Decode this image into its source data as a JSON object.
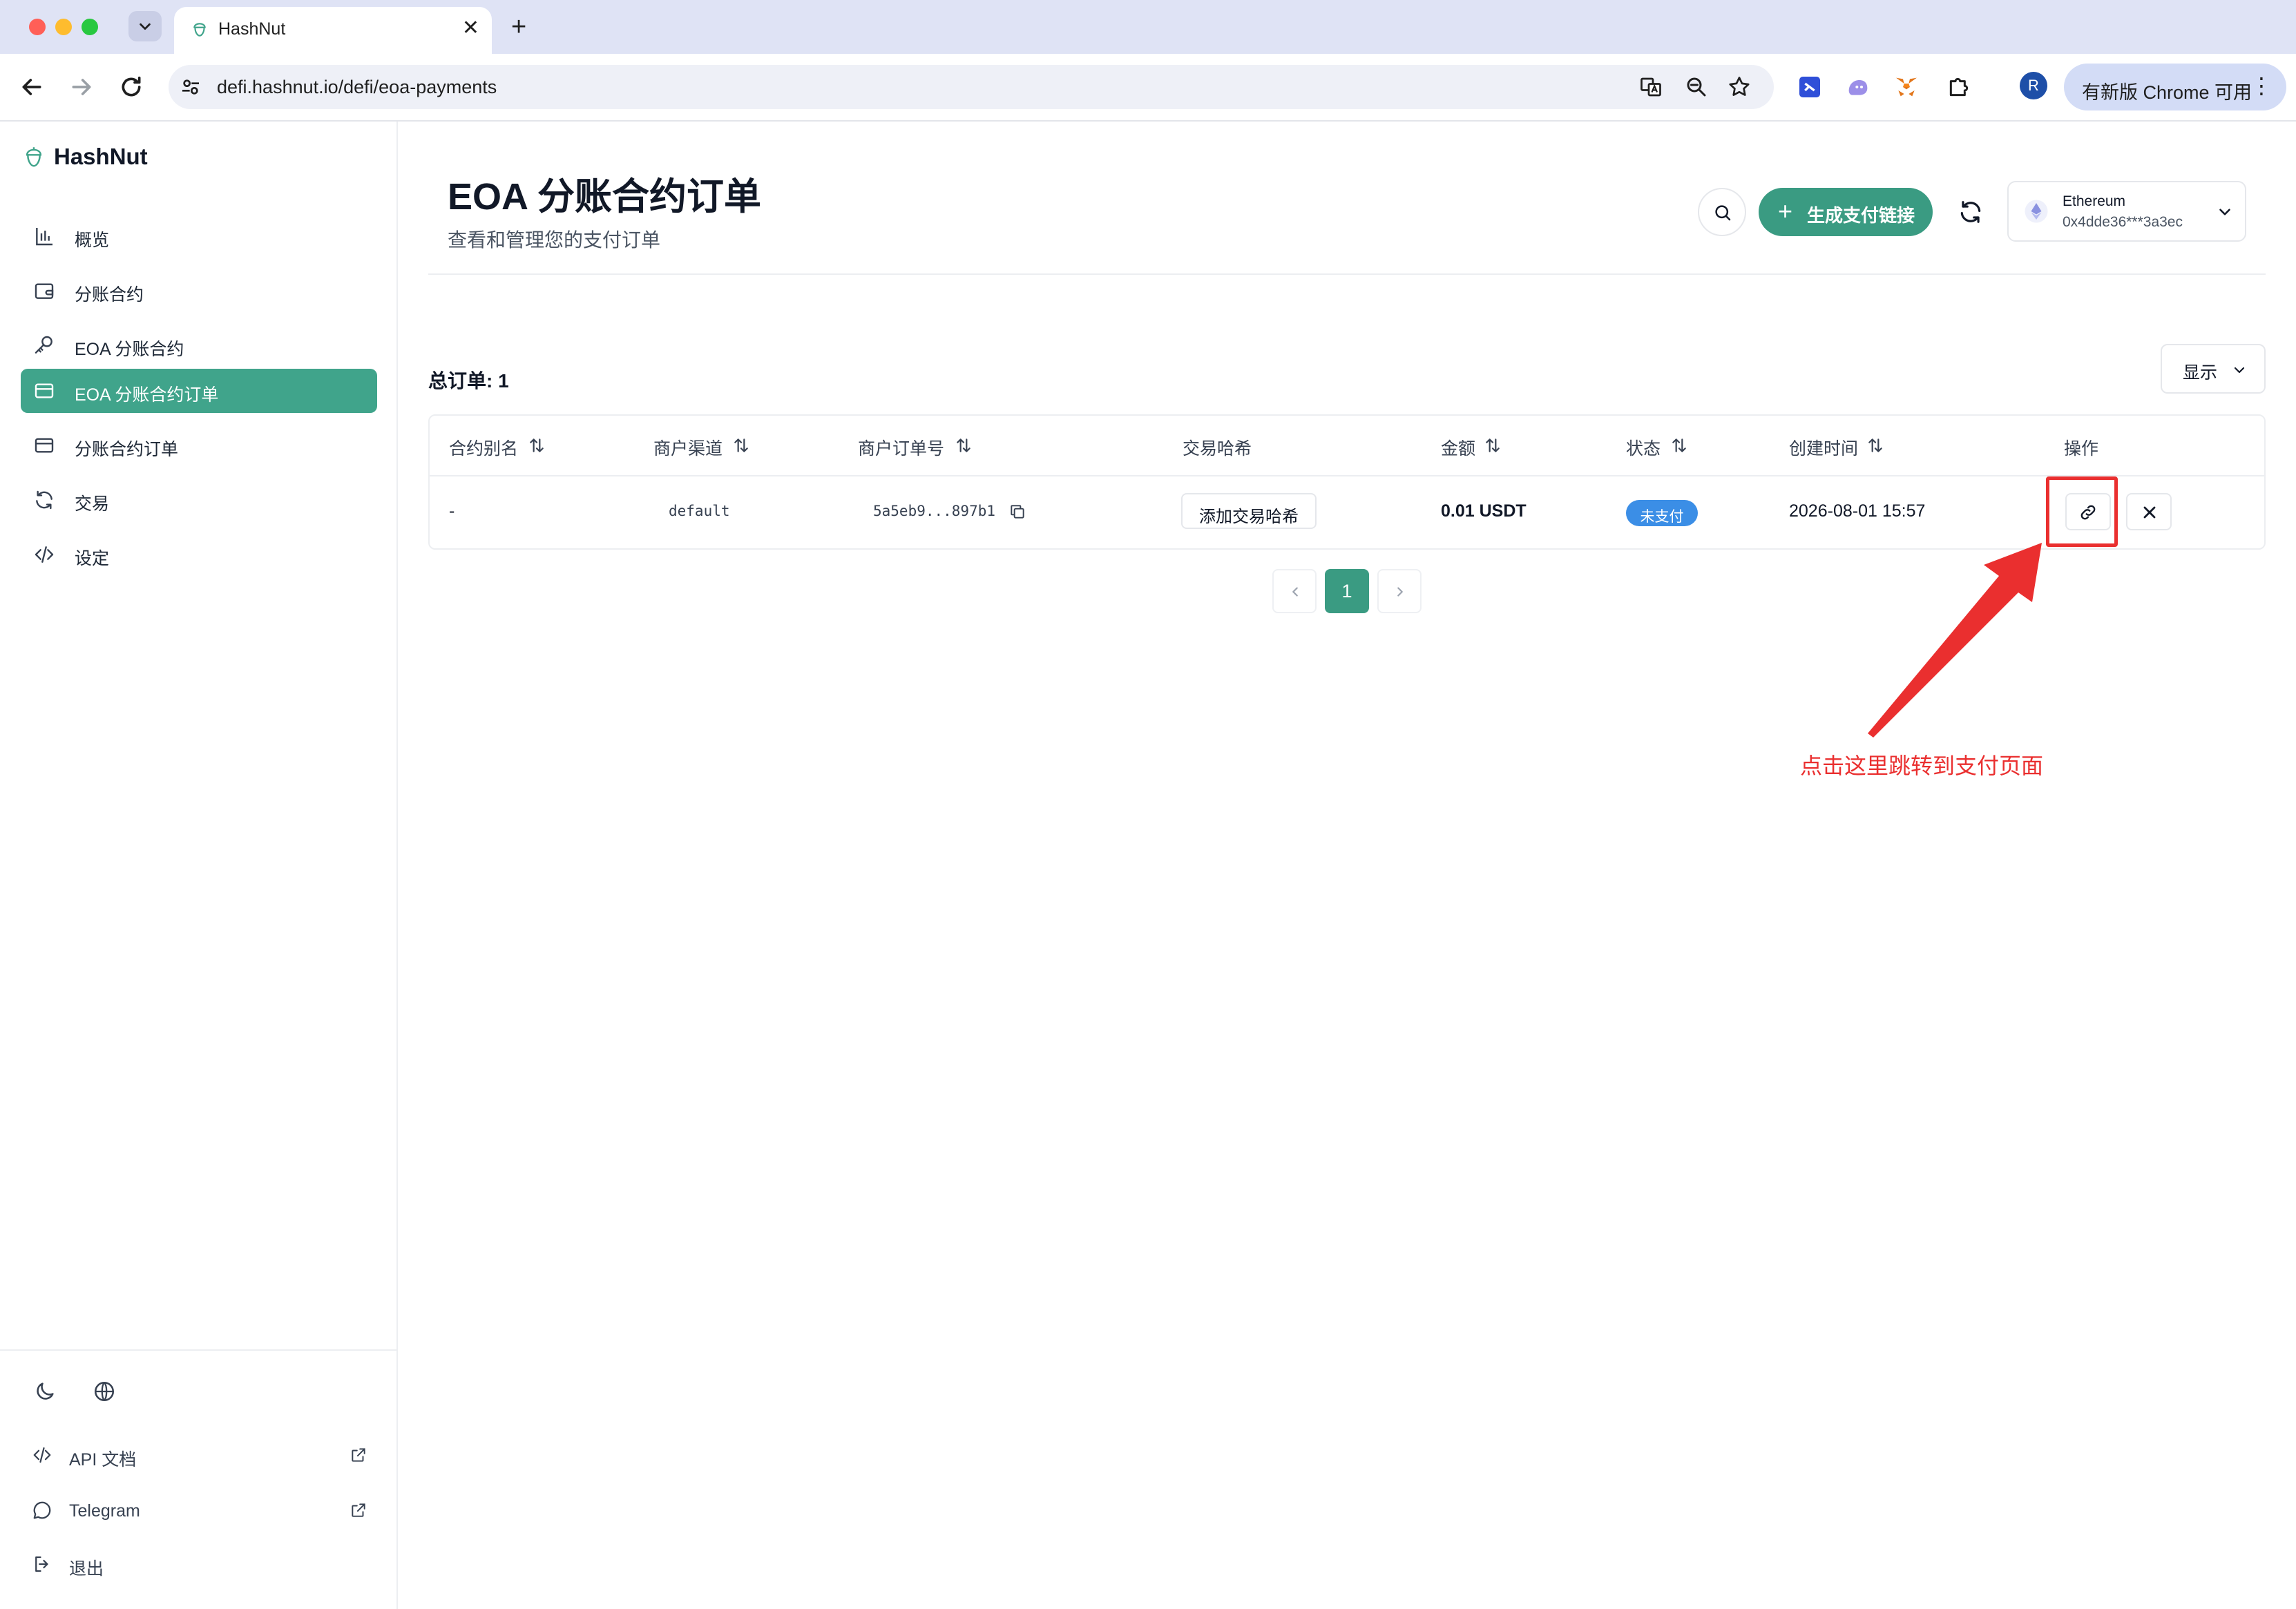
{
  "browser": {
    "tab_title": "HashNut",
    "tab_close": "✕",
    "new_tab": "+",
    "url": "defi.hashnut.io/defi/eoa-payments",
    "avatar_initial": "R",
    "update_label": "有新版 Chrome 可用",
    "menu_dots": "⋮"
  },
  "sidebar": {
    "brand": "HashNut",
    "items": [
      {
        "label": "概览",
        "icon": "bar-chart-icon",
        "active": false
      },
      {
        "label": "分账合约",
        "icon": "wallet-icon",
        "active": false
      },
      {
        "label": "EOA 分账合约",
        "icon": "key-icon",
        "active": false
      },
      {
        "label": "EOA 分账合约订单",
        "icon": "card-icon",
        "active": true
      },
      {
        "label": "分账合约订单",
        "icon": "card-icon",
        "active": false
      },
      {
        "label": "交易",
        "icon": "refresh-icon",
        "active": false
      },
      {
        "label": "设定",
        "icon": "code-icon",
        "active": false
      }
    ],
    "footer_links": [
      {
        "label": "API 文档",
        "icon": "code-icon",
        "external": true
      },
      {
        "label": "Telegram",
        "icon": "chat-icon",
        "external": true
      },
      {
        "label": "退出",
        "icon": "logout-icon",
        "external": false
      }
    ]
  },
  "header": {
    "title": "EOA 分账合约订单",
    "subtitle": "查看和管理您的支付订单",
    "generate_link_label": "生成支付链接",
    "generate_link_plus": "+",
    "wallet": {
      "network": "Ethereum",
      "address": "0x4dde36***3a3ec"
    }
  },
  "orders": {
    "total_label": "总订单: 1",
    "display_label": "显示",
    "columns": [
      "合约别名",
      "商户渠道",
      "商户订单号",
      "交易哈希",
      "金额",
      "状态",
      "创建时间",
      "操作"
    ],
    "rows": [
      {
        "alias": "-",
        "channel": "default",
        "order_no": "5a5eb9...897b1",
        "tx_hash_button": "添加交易哈希",
        "amount": "0.01 USDT",
        "status": "未支付",
        "created_at": "2026-08-01 15:57"
      }
    ]
  },
  "pagination": {
    "current": "1"
  },
  "annotation": {
    "text": "点击这里跳转到支付页面"
  },
  "colors": {
    "accent": "#40a48b",
    "button_green": "#3a9b82",
    "status_blue": "#3b8ee6",
    "annotation_red": "#ea2f2f"
  }
}
